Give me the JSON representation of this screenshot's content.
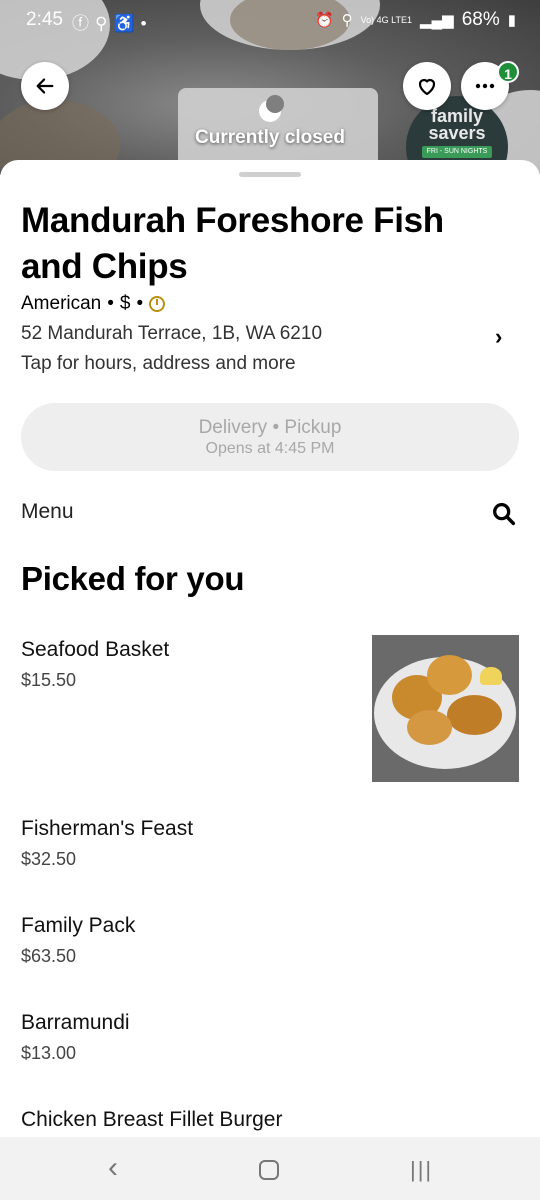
{
  "status_bar": {
    "time": "2:45",
    "left_icons": [
      "facebook-icon",
      "location-icon",
      "accessibility-icon",
      "dot-icon"
    ],
    "network_label": "Vo) 4G LTE1",
    "battery": "68%"
  },
  "hero": {
    "status_label": "Currently closed",
    "promo_logo_text": "family savers",
    "promo_logo_subtext": "FRI - SUN NIGHTS",
    "notification_count": "1"
  },
  "store": {
    "name": "Mandurah Foreshore Fish and Chips",
    "cuisine": "American",
    "separator": "•",
    "price_level": "$",
    "address": "52 Mandurah Terrace, 1B, WA 6210",
    "info_hint": "Tap for hours, address and more"
  },
  "mode": {
    "label": "Delivery • Pickup",
    "opens": "Opens at 4:45 PM"
  },
  "menu": {
    "label": "Menu",
    "section_title": "Picked for you",
    "items": [
      {
        "name": "Seafood Basket",
        "price": "$15.50"
      },
      {
        "name": "Fisherman's Feast",
        "price": "$32.50"
      },
      {
        "name": "Family Pack",
        "price": "$63.50"
      },
      {
        "name": "Barramundi",
        "price": "$13.00"
      },
      {
        "name": "Chicken Breast Fillet Burger",
        "price": ""
      }
    ]
  },
  "colors": {
    "badge_green": "#1f8f3a",
    "pill_background": "#eeeeee",
    "muted_text": "#a8a8a8",
    "icon_gold": "#b8920f"
  }
}
